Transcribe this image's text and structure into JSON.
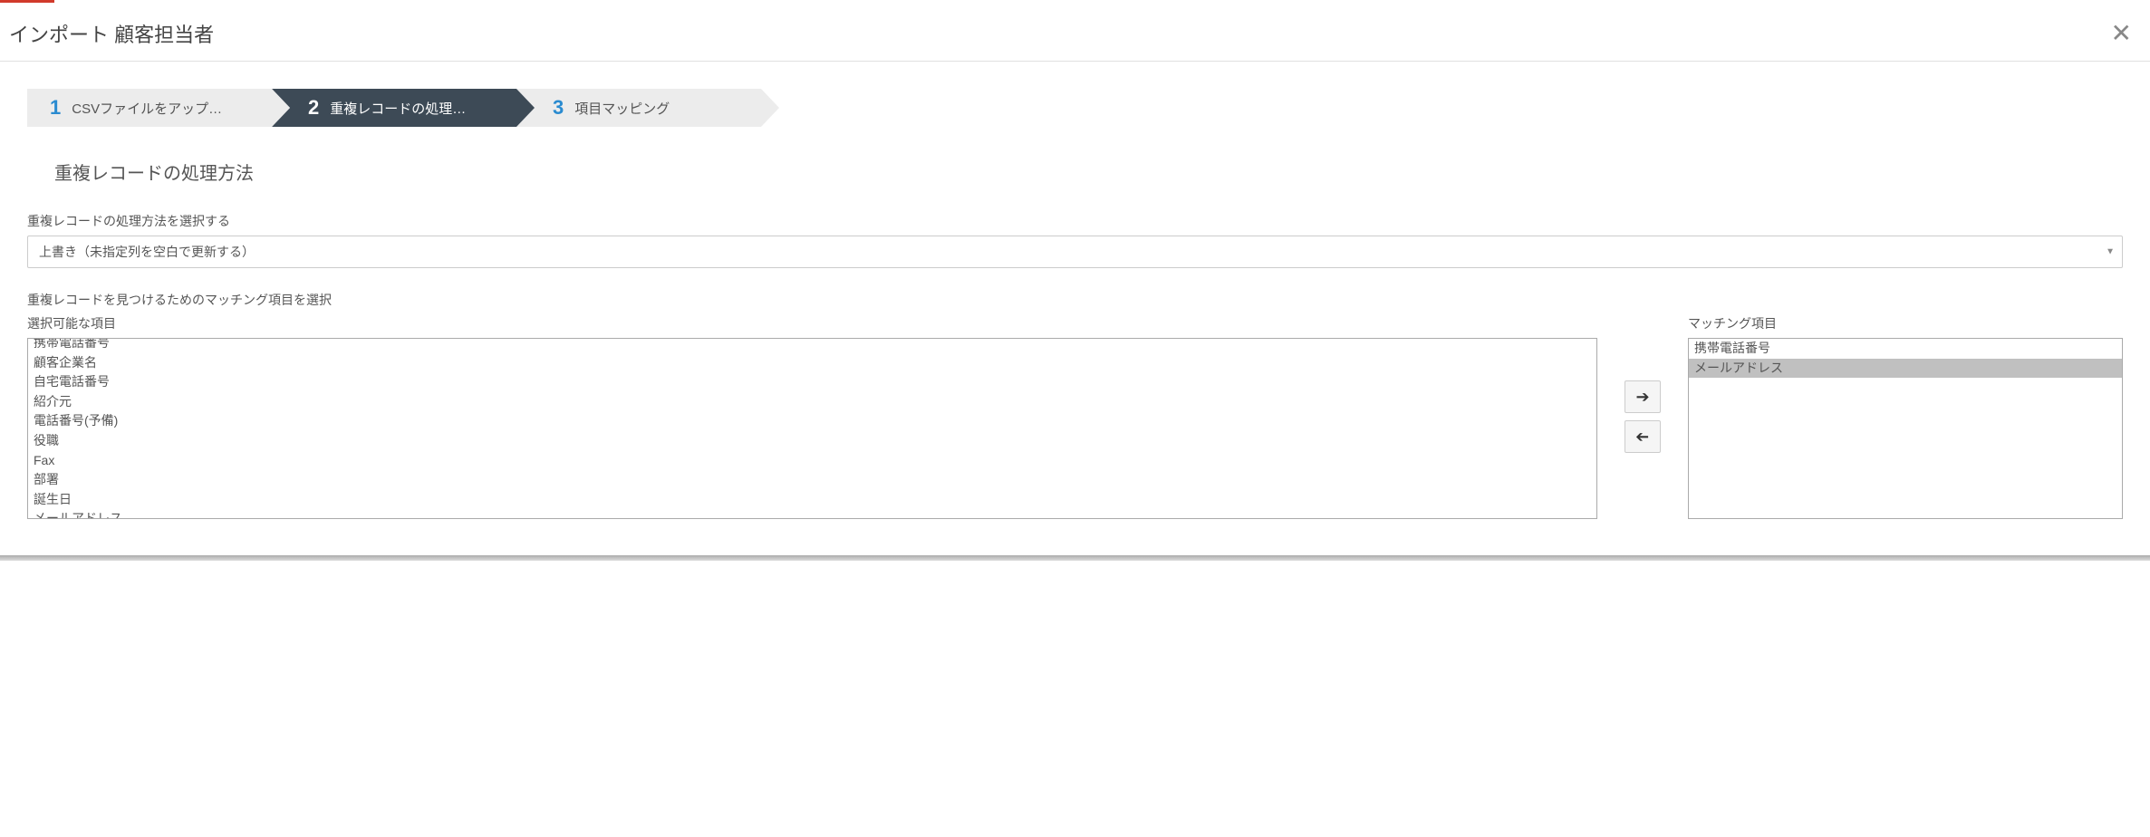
{
  "header": {
    "title": "インポート 顧客担当者"
  },
  "wizard": {
    "steps": [
      {
        "num": "1",
        "label": "CSVファイルをアップ…"
      },
      {
        "num": "2",
        "label": "重複レコードの処理…"
      },
      {
        "num": "3",
        "label": "項目マッピング"
      }
    ]
  },
  "section": {
    "title": "重複レコードの処理方法"
  },
  "duplicate_method": {
    "label": "重複レコードの処理方法を選択する",
    "selected": "上書き（未指定列を空白で更新する）"
  },
  "matching": {
    "label": "重複レコードを見つけるためのマッチング項目を選択",
    "available_label": "選択可能な項目",
    "selected_label": "マッチング項目",
    "available": [
      "携帯電話番号",
      "顧客企業名",
      "自宅電話番号",
      "紹介元",
      "電話番号(予備)",
      "役職",
      "Fax",
      "部署",
      "誕生日",
      "メールアドレス"
    ],
    "selected": [
      "携帯電話番号",
      "メールアドレス"
    ]
  }
}
